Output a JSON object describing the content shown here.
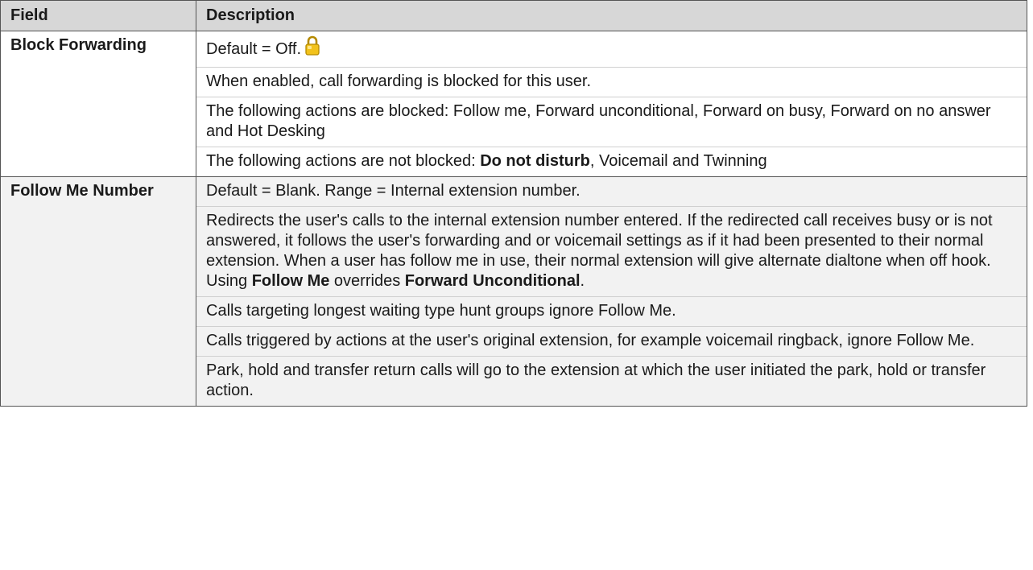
{
  "header": {
    "field": "Field",
    "description": "Description"
  },
  "rows": [
    {
      "field": "Block Forwarding",
      "paragraphs": [
        {
          "text": "Default = Off.",
          "icon": "lock-icon"
        },
        {
          "text": "When enabled, call forwarding is blocked for this user."
        },
        {
          "text": "The following actions are blocked: Follow me, Forward unconditional, Forward on busy, Forward on no answer and Hot Desking"
        },
        {
          "prefix": "The following actions are not blocked: ",
          "bold": "Do not disturb",
          "suffix": ", Voicemail and Twinning"
        }
      ]
    },
    {
      "field": "Follow Me Number",
      "paragraphs": [
        {
          "text": "Default = Blank. Range = Internal extension number."
        },
        {
          "text": "Redirects the user's calls to the internal extension number entered. If the redirected call receives busy or is not answered, it follows the user's forwarding and or voicemail settings as if it had been presented to their normal extension. When a user has follow me in use, their normal extension will give alternate dialtone when off hook. Using ",
          "bold1": "Follow Me",
          "mid": " overrides ",
          "bold2": "Forward Unconditional",
          "end": "."
        },
        {
          "text": "Calls targeting longest waiting type hunt groups ignore Follow Me."
        },
        {
          "text": "Calls triggered by actions at the user's original extension, for example voicemail ringback, ignore Follow Me."
        },
        {
          "text": "Park, hold and transfer return calls will go to the extension at which the user initiated the park, hold or transfer action."
        }
      ]
    }
  ]
}
